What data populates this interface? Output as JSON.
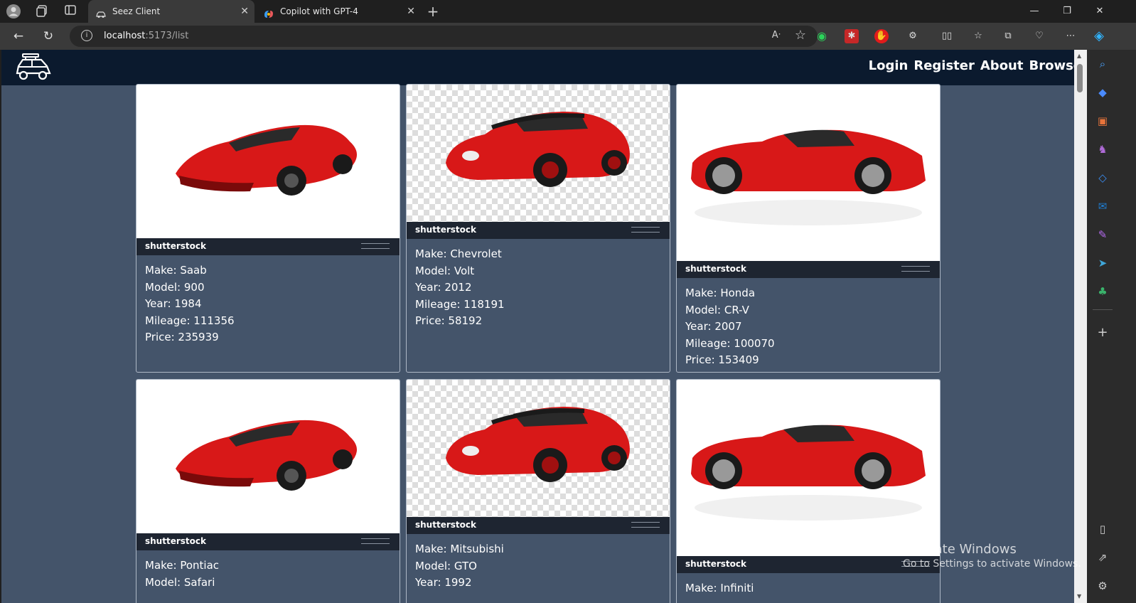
{
  "browser": {
    "tabs": [
      {
        "title": "Seez Client",
        "active": true
      },
      {
        "title": "Copilot with GPT-4",
        "active": false
      }
    ],
    "url": {
      "host": "localhost",
      "path": ":5173/list"
    },
    "new_tab_label": "+"
  },
  "nav": {
    "links": [
      "Login",
      "Register",
      "About",
      "Browse"
    ]
  },
  "cars": [
    {
      "make": "Make: Saab",
      "model": "Model: 900",
      "year": "Year: 1984",
      "mileage": "Mileage: 111356",
      "price": "Price: 235939",
      "image": "red-lamborghini"
    },
    {
      "make": "Make: Chevrolet",
      "model": "Model: Volt",
      "year": "Year: 2012",
      "mileage": "Mileage: 118191",
      "price": "Price: 58192",
      "image": "red-porsche"
    },
    {
      "make": "Make: Honda",
      "model": "Model: CR-V",
      "year": "Year: 2007",
      "mileage": "Mileage: 100070",
      "price": "Price: 153409",
      "image": "red-ferrari"
    },
    {
      "make": "Make: Pontiac",
      "model": "Model: Safari",
      "image": "red-lamborghini"
    },
    {
      "make": "Make: Mitsubishi",
      "model": "Model: GTO",
      "year": "Year: 1992",
      "image": "red-porsche"
    },
    {
      "make": "Make: Infiniti",
      "image": "red-ferrari"
    }
  ],
  "image_brand": "shutterstock",
  "watermark": {
    "line1": "Activate Windows",
    "line2": "Go to Settings to activate Windows."
  },
  "colors": {
    "page_bg": "#44546a",
    "navbar_bg": "#0b1a2e",
    "card_border": "#aeb8c6",
    "car_red": "#d81818"
  }
}
